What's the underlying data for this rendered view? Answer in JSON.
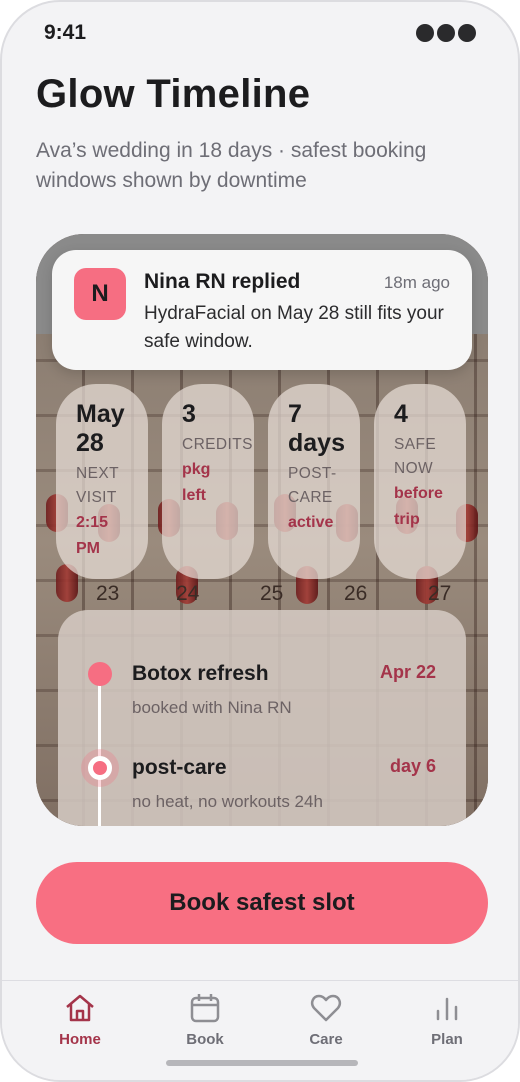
{
  "status": {
    "time": "9:41"
  },
  "header": {
    "title": "Glow Timeline",
    "subtitle": "Ava’s wedding in 18 days · safest booking windows shown by downtime"
  },
  "notification": {
    "avatar_letter": "N",
    "title": "Nina RN replied",
    "time": "18m ago",
    "body": "HydraFacial on May 28 still fits your safe window."
  },
  "photo_calendar_numbers": [
    "23",
    "24",
    "25",
    "26",
    "27"
  ],
  "stats": [
    {
      "big_1": "May",
      "big_2": "28",
      "small_1": "NEXT",
      "small_2": "VISIT",
      "accent_1": "2:15",
      "accent_2": "PM"
    },
    {
      "big_1": "3",
      "big_2": "",
      "small_1": "CREDITS",
      "small_2": "",
      "accent_1": "pkg",
      "accent_2": "left"
    },
    {
      "big_1": "7",
      "big_2": "days",
      "small_1": "POST-",
      "small_2": "CARE",
      "accent_1": "active",
      "accent_2": ""
    },
    {
      "big_1": "4",
      "big_2": "",
      "small_1": "SAFE",
      "small_2": "NOW",
      "accent_1": "before",
      "accent_2": "trip"
    }
  ],
  "timeline": [
    {
      "title": "Botox refresh",
      "subtitle": "booked with Nina RN",
      "when": "Apr 22"
    },
    {
      "title": "post-care",
      "subtitle": "no heat, no workouts 24h",
      "when": "day 6"
    }
  ],
  "cta": {
    "label": "Book safest slot"
  },
  "tabs": [
    {
      "label": "Home",
      "icon": "home-icon",
      "active": true
    },
    {
      "label": "Book",
      "icon": "calendar-icon",
      "active": false
    },
    {
      "label": "Care",
      "icon": "heart-icon",
      "active": false
    },
    {
      "label": "Plan",
      "icon": "bar-chart-icon",
      "active": false
    }
  ],
  "colors": {
    "accent": "#f86f82",
    "accent_text": "#a4344a",
    "background": "#f3f3f5"
  }
}
